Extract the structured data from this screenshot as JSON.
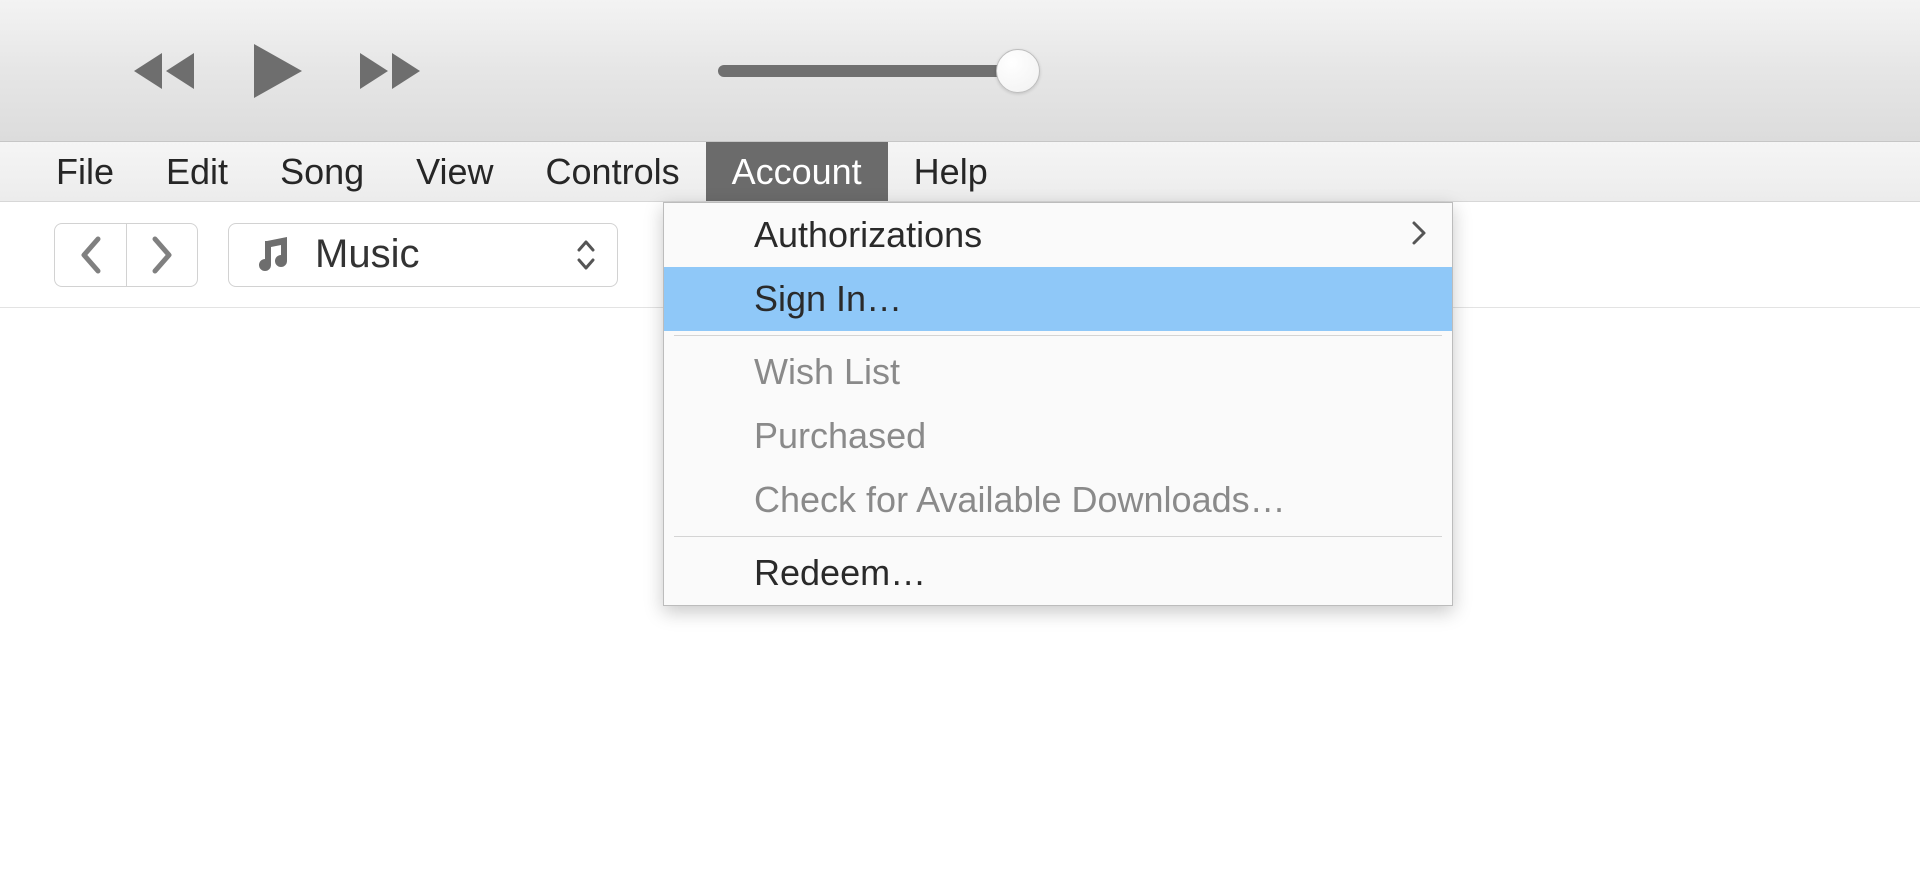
{
  "menu": {
    "items": [
      "File",
      "Edit",
      "Song",
      "View",
      "Controls",
      "Account",
      "Help"
    ],
    "active_index": 5
  },
  "library_picker": {
    "label": "Music"
  },
  "account_menu": {
    "items": [
      {
        "label": "Authorizations",
        "has_submenu": true,
        "enabled": true
      },
      {
        "label": "Sign In…",
        "enabled": true,
        "highlighted": true
      },
      {
        "sep": true
      },
      {
        "label": "Wish List",
        "enabled": false
      },
      {
        "label": "Purchased",
        "enabled": false
      },
      {
        "label": "Check for Available Downloads…",
        "enabled": false
      },
      {
        "sep": true
      },
      {
        "label": "Redeem…",
        "enabled": true
      }
    ]
  },
  "colors": {
    "highlight": "#8fc8f8",
    "menu_active_bg": "#6b6b6b"
  }
}
